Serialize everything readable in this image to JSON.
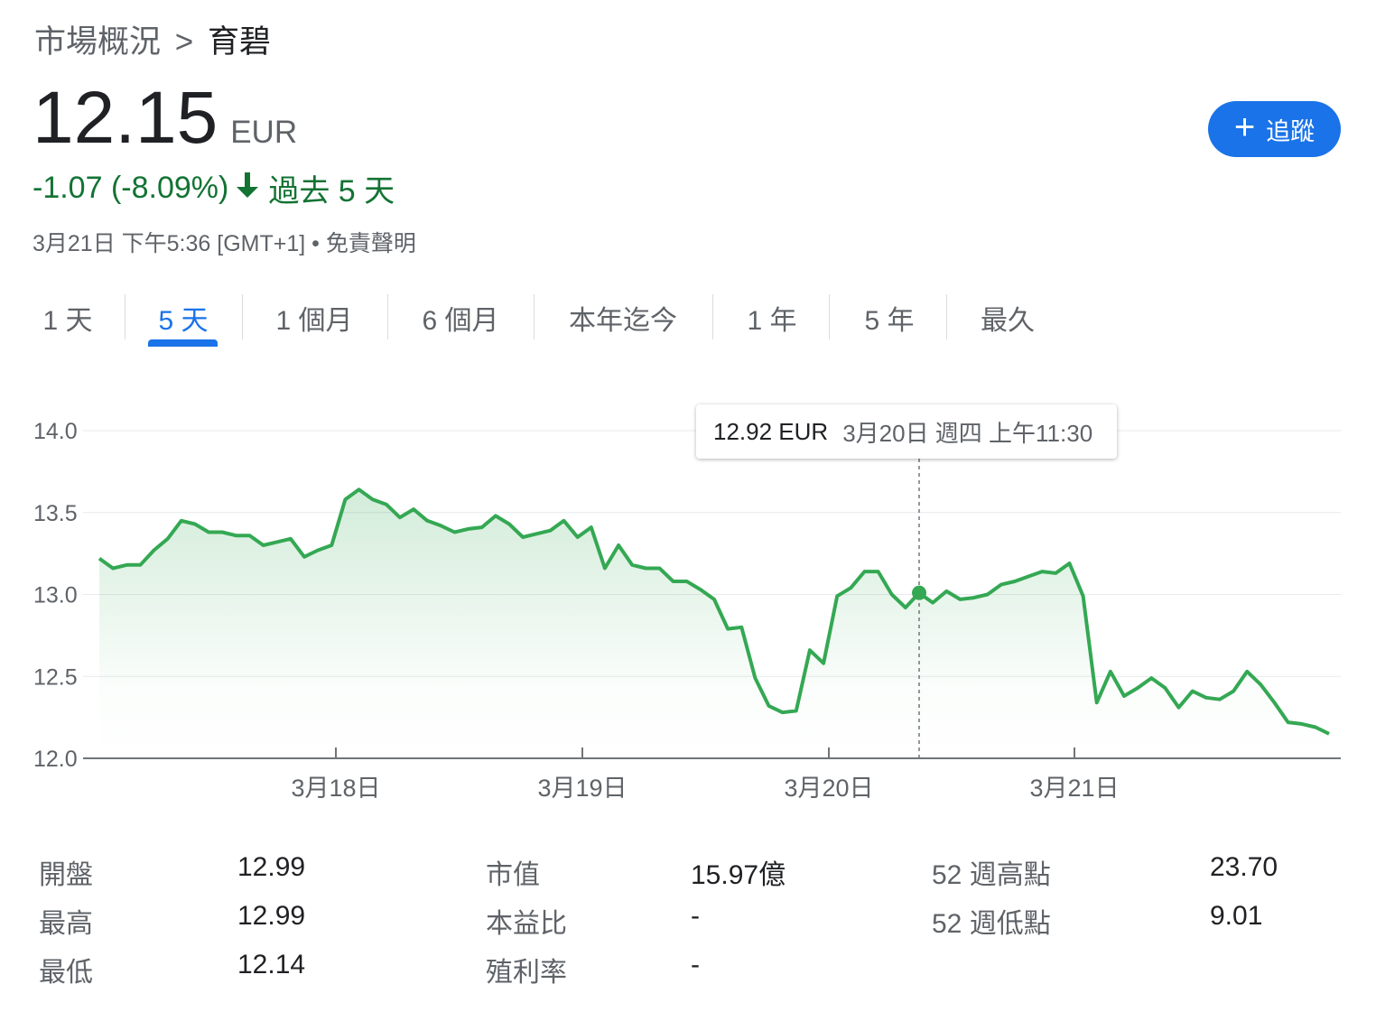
{
  "breadcrumb": {
    "parent": "市場概況",
    "separator": ">",
    "current": "育碧"
  },
  "quote": {
    "price": "12.15",
    "currency": "EUR",
    "change": "-1.07 (-8.09%)",
    "period": "過去 5 天",
    "timestamp": "3月21日 下午5:36 [GMT+1] • 免責聲明"
  },
  "follow_button": {
    "label": "追蹤",
    "icon": "plus-icon"
  },
  "range_tabs": [
    {
      "label": "1 天",
      "active": false
    },
    {
      "label": "5 天",
      "active": true
    },
    {
      "label": "1 個月",
      "active": false
    },
    {
      "label": "6 個月",
      "active": false
    },
    {
      "label": "本年迄今",
      "active": false
    },
    {
      "label": "1 年",
      "active": false
    },
    {
      "label": "5 年",
      "active": false
    },
    {
      "label": "最久",
      "active": false
    }
  ],
  "tooltip": {
    "price": "12.92 EUR",
    "date": "3月20日 週四 上午11:30"
  },
  "colors": {
    "line": "#34a853",
    "change_text": "#137333",
    "accent": "#1a73e8",
    "grid": "#e8eaed"
  },
  "chart_data": {
    "type": "line",
    "ylim": [
      12.0,
      14.0
    ],
    "y_ticks": [
      "14.0",
      "13.5",
      "13.0",
      "12.5",
      "12.0"
    ],
    "x_ticks": [
      "3月18日",
      "3月19日",
      "3月20日",
      "3月21日"
    ],
    "grid": "horizontal",
    "hover_index": 60,
    "series": [
      {
        "values": [
          13.22,
          13.16,
          13.18,
          13.18,
          13.27,
          13.34,
          13.45,
          13.43,
          13.38,
          13.38,
          13.36,
          13.36,
          13.3,
          13.32,
          13.34,
          13.23,
          13.27,
          13.3,
          13.58,
          13.64,
          13.58,
          13.55,
          13.47,
          13.52,
          13.45,
          13.42,
          13.38,
          13.4,
          13.41,
          13.48,
          13.43,
          13.35,
          13.37,
          13.39,
          13.45,
          13.35,
          13.41,
          13.16,
          13.3,
          13.18,
          13.16,
          13.16,
          13.08,
          13.08,
          13.03,
          12.97,
          12.79,
          12.8,
          12.49,
          12.32,
          12.28,
          12.29,
          12.66,
          12.58,
          12.99,
          13.04,
          13.14,
          13.14,
          13.0,
          12.92,
          13.01,
          12.95,
          13.02,
          12.97,
          12.98,
          13.0,
          13.06,
          13.08,
          13.11,
          13.14,
          13.13,
          13.19,
          12.99,
          12.34,
          12.53,
          12.38,
          12.43,
          12.49,
          12.43,
          12.31,
          12.41,
          12.37,
          12.36,
          12.41,
          12.53,
          12.45,
          12.34,
          12.22,
          12.21,
          12.19,
          12.15
        ]
      }
    ]
  },
  "stats": [
    {
      "label": "開盤",
      "value": "12.99"
    },
    {
      "label": "最高",
      "value": "12.99"
    },
    {
      "label": "最低",
      "value": "12.14"
    },
    {
      "label": "市值",
      "value": "15.97億"
    },
    {
      "label": "本益比",
      "value": "-"
    },
    {
      "label": "殖利率",
      "value": "-"
    },
    {
      "label": "52 週高點",
      "value": "23.70"
    },
    {
      "label": "52 週低點",
      "value": "9.01"
    }
  ]
}
